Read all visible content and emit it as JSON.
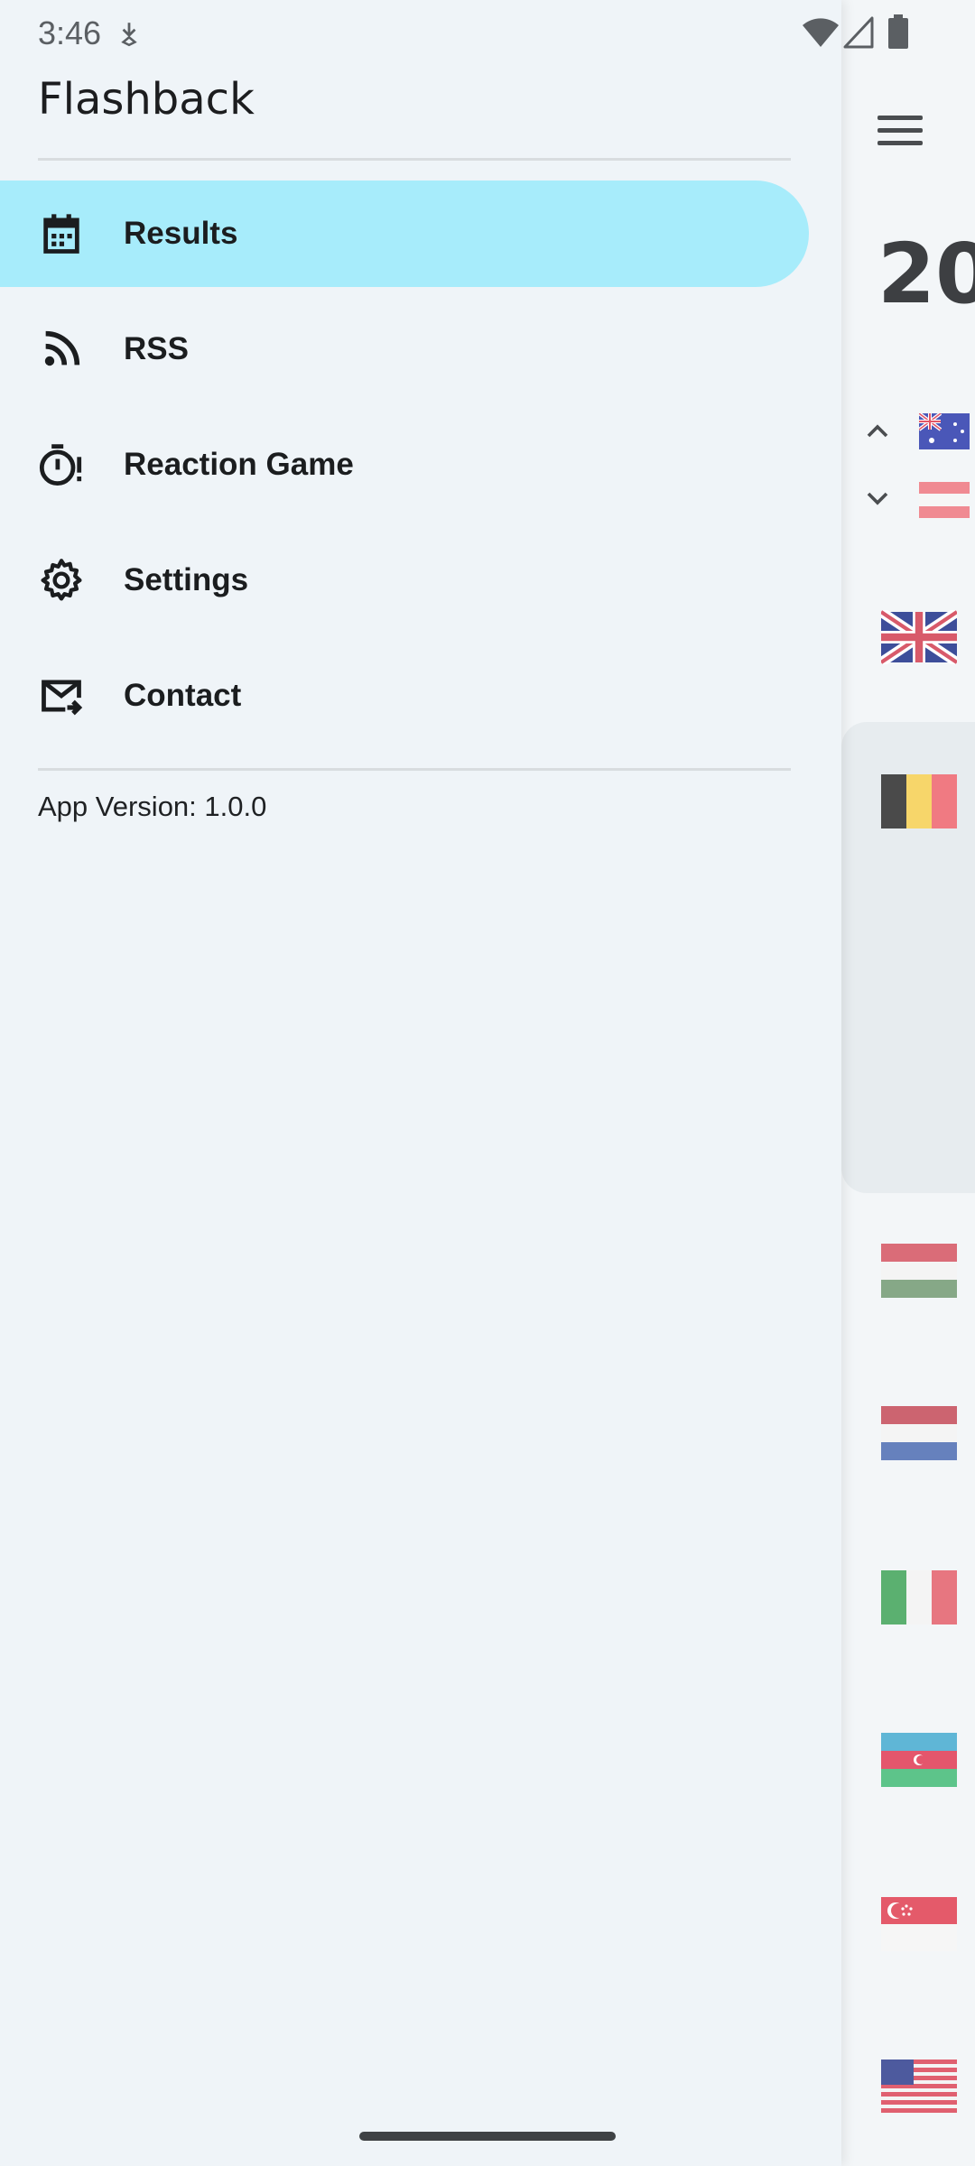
{
  "status_bar": {
    "time": "3:46",
    "icons": [
      "download-icon",
      "wifi-icon",
      "signal-icon",
      "battery-icon"
    ]
  },
  "background_app": {
    "year_fragment": "20",
    "menu_icon": "hamburger-icon",
    "flags": [
      "australia-flag",
      "austria-flag",
      "uk-flag",
      "belgium-flag",
      "hungary-flag",
      "netherlands-flag",
      "italy-flag",
      "azerbaijan-flag",
      "singapore-flag",
      "usa-flag"
    ]
  },
  "drawer": {
    "title": "Flashback",
    "items": [
      {
        "label": "Results",
        "icon": "calendar-icon",
        "active": true
      },
      {
        "label": "RSS",
        "icon": "rss-icon",
        "active": false
      },
      {
        "label": "Reaction Game",
        "icon": "timer-icon",
        "active": false
      },
      {
        "label": "Settings",
        "icon": "gear-icon",
        "active": false
      },
      {
        "label": "Contact",
        "icon": "mail-forward-icon",
        "active": false
      }
    ],
    "app_version": "App Version: 1.0.0"
  },
  "colors": {
    "active_item_bg": "#a7ecfb",
    "drawer_bg": "#eff4f8",
    "text": "#1b1d1f"
  }
}
